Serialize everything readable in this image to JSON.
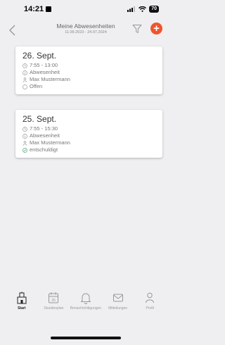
{
  "status": {
    "time": "14:21",
    "battery": "70"
  },
  "header": {
    "title": "Meine Abwesenheiten",
    "date_range": "11.09.2023 - 24.07.2024"
  },
  "entries": [
    {
      "date": "26. Sept.",
      "time": "7:55 - 13:00",
      "type": "Abwesenheit",
      "person": "Max Mustermann",
      "status": "Offen"
    },
    {
      "date": "25. Sept.",
      "time": "7:55 - 15:30",
      "type": "Abwesenheit",
      "person": "Max Mustermann",
      "status": "entschuldigt"
    }
  ],
  "nav": [
    {
      "label": "Start",
      "icon": "home-icon",
      "active": true
    },
    {
      "label": "Stundenplan",
      "icon": "calendar-icon",
      "active": false
    },
    {
      "label": "Benachrichtigungen",
      "icon": "bell-icon",
      "active": false
    },
    {
      "label": "Mitteilungen",
      "icon": "mail-icon",
      "active": false
    },
    {
      "label": "Profil",
      "icon": "person-icon",
      "active": false
    }
  ],
  "colors": {
    "accent": "#f0542c",
    "success": "#4aa47a",
    "background": "#efeff2"
  }
}
